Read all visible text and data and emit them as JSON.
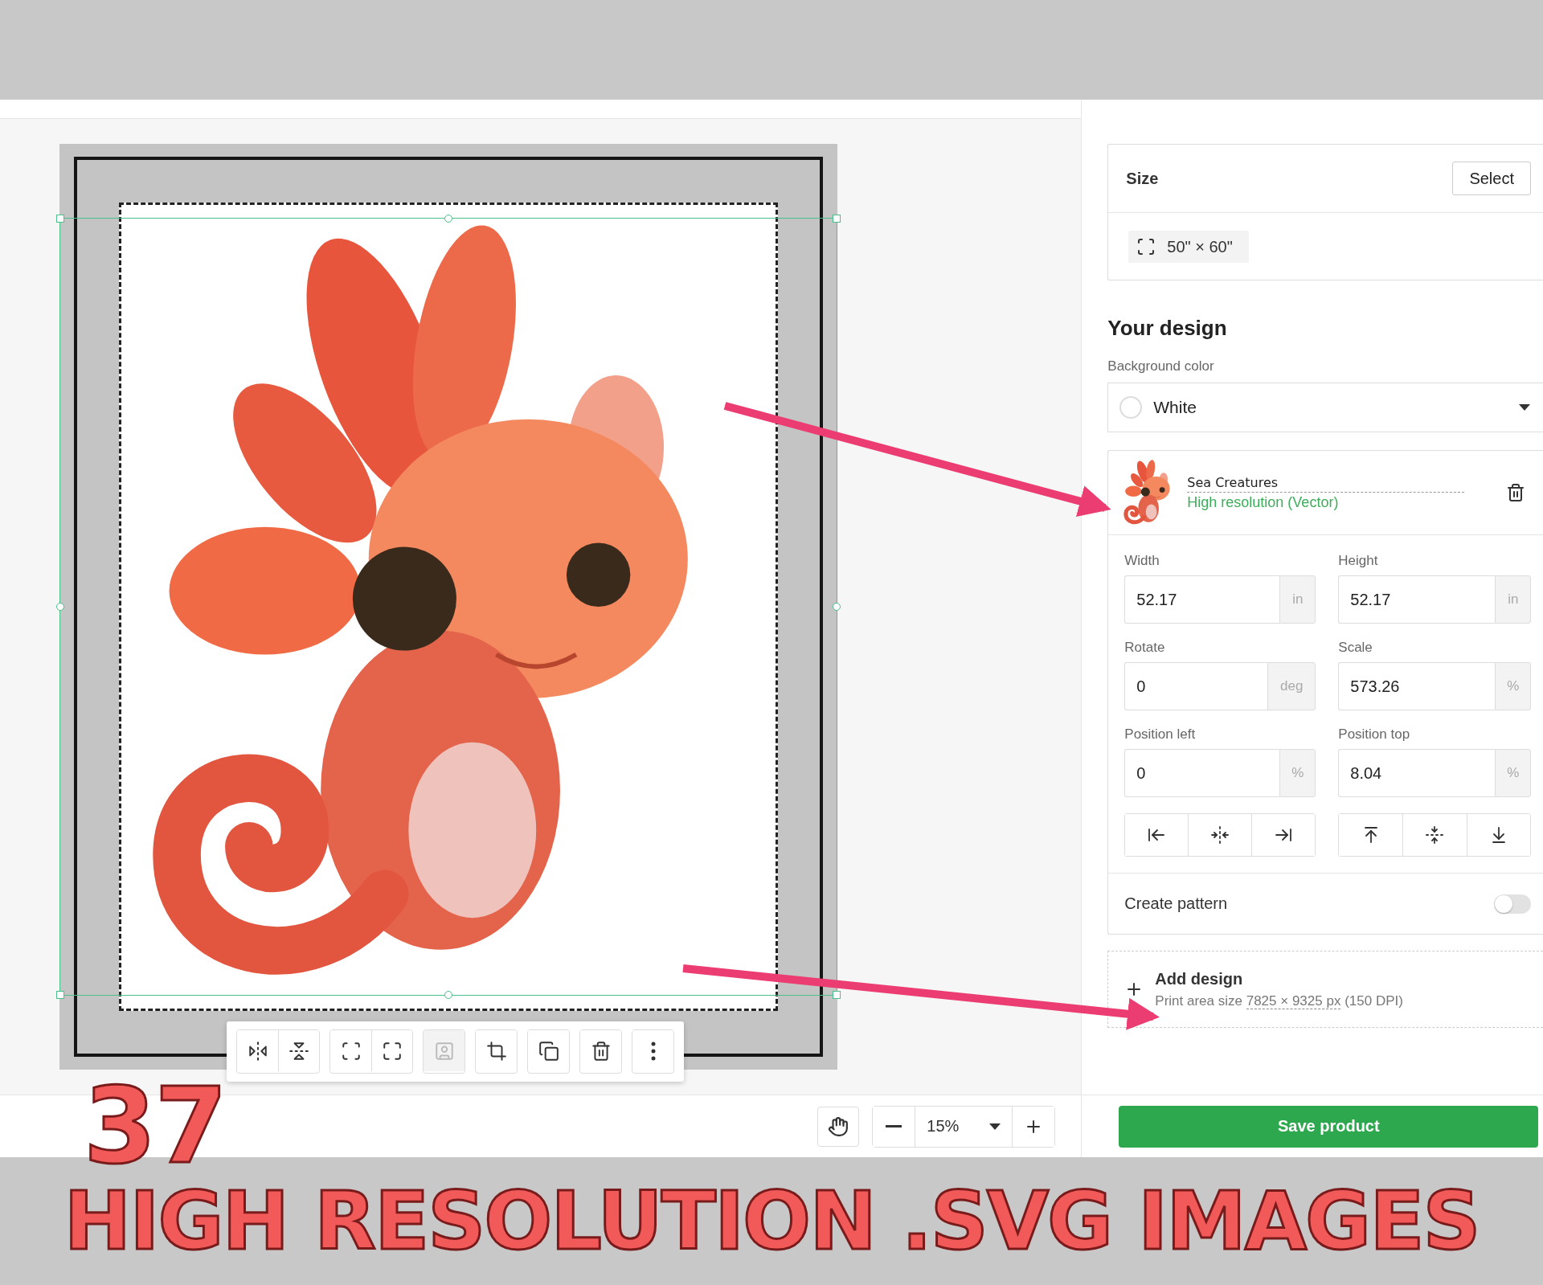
{
  "canvas": {
    "toolbar_groups": [
      [
        {
          "kind": "flip-horizontal",
          "disabled": false
        },
        {
          "kind": "flip-vertical",
          "disabled": false
        }
      ],
      [
        {
          "kind": "fit",
          "disabled": false
        },
        {
          "kind": "fill",
          "disabled": false
        }
      ],
      [
        {
          "kind": "remove-background",
          "disabled": true
        }
      ],
      [
        {
          "kind": "crop",
          "disabled": false
        }
      ],
      [
        {
          "kind": "duplicate",
          "disabled": false
        }
      ],
      [
        {
          "kind": "delete",
          "disabled": false
        }
      ],
      [
        {
          "kind": "more",
          "disabled": false
        }
      ]
    ],
    "zoom": "15%"
  },
  "size_card": {
    "title": "Size",
    "select_button": "Select",
    "size": "50\" × 60\""
  },
  "design": {
    "heading": "Your design",
    "background_label": "Background color",
    "background_value": "White",
    "layer": {
      "name": "Sea Creatures",
      "quality": "High resolution (Vector)"
    },
    "fields": [
      {
        "label": "Width",
        "value": "52.17",
        "unit": "in"
      },
      {
        "label": "Height",
        "value": "52.17",
        "unit": "in"
      },
      {
        "label": "Rotate",
        "value": "0",
        "unit": "deg"
      },
      {
        "label": "Scale",
        "value": "573.26",
        "unit": "%"
      },
      {
        "label": "Position left",
        "value": "0",
        "unit": "%"
      },
      {
        "label": "Position top",
        "value": "8.04",
        "unit": "%"
      }
    ],
    "align_groups": [
      [
        {
          "kind": "left"
        },
        {
          "kind": "center-horizontal"
        },
        {
          "kind": "right"
        }
      ],
      [
        {
          "kind": "top"
        },
        {
          "kind": "center-vertical"
        },
        {
          "kind": "bottom"
        }
      ]
    ],
    "pattern": {
      "label": "Create pattern",
      "on": false
    },
    "add_design": {
      "title": "Add design",
      "note_prefix": "Print area size",
      "note_link": "7825 × 9325 px",
      "note_suffix": "(150 DPI)"
    }
  },
  "save_button": "Save product",
  "banner": {
    "count": "37",
    "headline": "HIGH RESOLUTION .SVG IMAGES"
  }
}
